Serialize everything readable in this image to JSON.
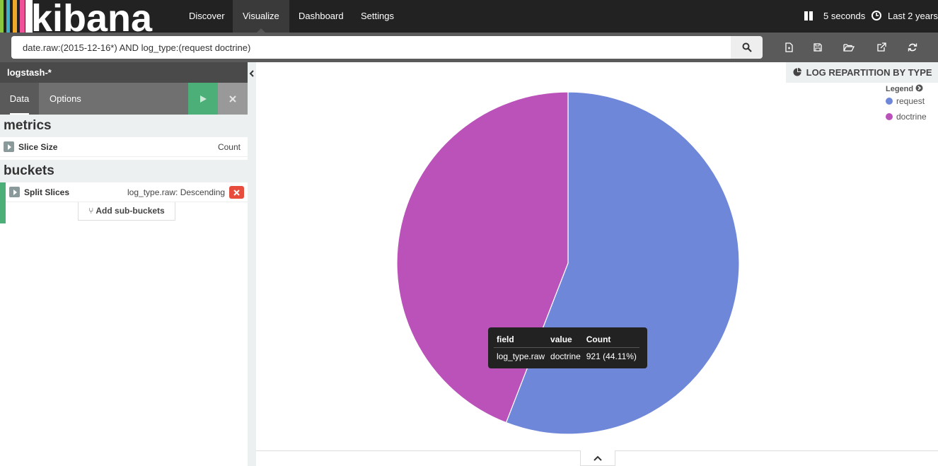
{
  "app": {
    "logo_text": "kibana"
  },
  "nav": [
    {
      "label": "Discover"
    },
    {
      "label": "Visualize"
    },
    {
      "label": "Dashboard"
    },
    {
      "label": "Settings"
    }
  ],
  "topright": {
    "refresh_interval": "5 seconds",
    "time_range": "Last 2 years"
  },
  "search": {
    "query": "date.raw:(2015-12-16*) AND log_type:(request doctrine)"
  },
  "sidebar": {
    "index_pattern": "logstash-*",
    "tabs": {
      "data": "Data",
      "options": "Options"
    },
    "metrics": {
      "title": "metrics",
      "items": [
        {
          "label": "Slice Size",
          "value": "Count"
        }
      ]
    },
    "buckets": {
      "title": "buckets",
      "items": [
        {
          "label": "Split Slices",
          "value": "log_type.raw: Descending"
        }
      ],
      "add_label": "Add sub-buckets"
    }
  },
  "visualization": {
    "title": "LOG REPARTITION BY TYPE",
    "legend_title": "Legend"
  },
  "chart_data": {
    "type": "pie",
    "categories": [
      "request",
      "doctrine"
    ],
    "values": [
      1167,
      921
    ],
    "colors": [
      "#6f87d8",
      "#ba52ba"
    ],
    "legend": "top-right"
  },
  "tooltip": {
    "headers": [
      "field",
      "value",
      "Count"
    ],
    "row": [
      "log_type.raw",
      "doctrine",
      "921 (44.11%)"
    ]
  },
  "icons": {
    "pause": "pause-icon",
    "clock": "clock-icon",
    "search": "search-icon",
    "new": "new-document-icon",
    "save": "save-icon",
    "open": "folder-open-icon",
    "share": "external-link-icon",
    "refresh": "refresh-icon",
    "play": "play-icon",
    "close": "close-icon",
    "pie": "pie-chart-icon",
    "chevron_up": "chevron-up-icon",
    "chevron_left": "chevron-left-icon"
  }
}
